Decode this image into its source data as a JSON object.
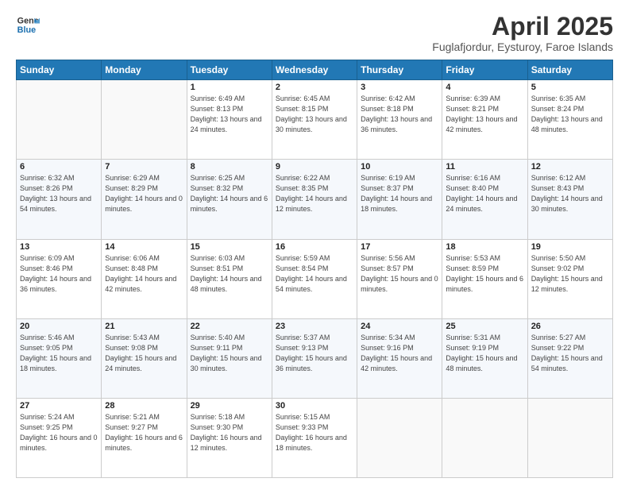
{
  "logo": {
    "line1": "General",
    "line2": "Blue"
  },
  "header": {
    "title": "April 2025",
    "subtitle": "Fuglafjordur, Eysturoy, Faroe Islands"
  },
  "weekdays": [
    "Sunday",
    "Monday",
    "Tuesday",
    "Wednesday",
    "Thursday",
    "Friday",
    "Saturday"
  ],
  "weeks": [
    [
      {
        "day": "",
        "info": ""
      },
      {
        "day": "",
        "info": ""
      },
      {
        "day": "1",
        "info": "Sunrise: 6:49 AM\nSunset: 8:13 PM\nDaylight: 13 hours\nand 24 minutes."
      },
      {
        "day": "2",
        "info": "Sunrise: 6:45 AM\nSunset: 8:15 PM\nDaylight: 13 hours\nand 30 minutes."
      },
      {
        "day": "3",
        "info": "Sunrise: 6:42 AM\nSunset: 8:18 PM\nDaylight: 13 hours\nand 36 minutes."
      },
      {
        "day": "4",
        "info": "Sunrise: 6:39 AM\nSunset: 8:21 PM\nDaylight: 13 hours\nand 42 minutes."
      },
      {
        "day": "5",
        "info": "Sunrise: 6:35 AM\nSunset: 8:24 PM\nDaylight: 13 hours\nand 48 minutes."
      }
    ],
    [
      {
        "day": "6",
        "info": "Sunrise: 6:32 AM\nSunset: 8:26 PM\nDaylight: 13 hours\nand 54 minutes."
      },
      {
        "day": "7",
        "info": "Sunrise: 6:29 AM\nSunset: 8:29 PM\nDaylight: 14 hours\nand 0 minutes."
      },
      {
        "day": "8",
        "info": "Sunrise: 6:25 AM\nSunset: 8:32 PM\nDaylight: 14 hours\nand 6 minutes."
      },
      {
        "day": "9",
        "info": "Sunrise: 6:22 AM\nSunset: 8:35 PM\nDaylight: 14 hours\nand 12 minutes."
      },
      {
        "day": "10",
        "info": "Sunrise: 6:19 AM\nSunset: 8:37 PM\nDaylight: 14 hours\nand 18 minutes."
      },
      {
        "day": "11",
        "info": "Sunrise: 6:16 AM\nSunset: 8:40 PM\nDaylight: 14 hours\nand 24 minutes."
      },
      {
        "day": "12",
        "info": "Sunrise: 6:12 AM\nSunset: 8:43 PM\nDaylight: 14 hours\nand 30 minutes."
      }
    ],
    [
      {
        "day": "13",
        "info": "Sunrise: 6:09 AM\nSunset: 8:46 PM\nDaylight: 14 hours\nand 36 minutes."
      },
      {
        "day": "14",
        "info": "Sunrise: 6:06 AM\nSunset: 8:48 PM\nDaylight: 14 hours\nand 42 minutes."
      },
      {
        "day": "15",
        "info": "Sunrise: 6:03 AM\nSunset: 8:51 PM\nDaylight: 14 hours\nand 48 minutes."
      },
      {
        "day": "16",
        "info": "Sunrise: 5:59 AM\nSunset: 8:54 PM\nDaylight: 14 hours\nand 54 minutes."
      },
      {
        "day": "17",
        "info": "Sunrise: 5:56 AM\nSunset: 8:57 PM\nDaylight: 15 hours\nand 0 minutes."
      },
      {
        "day": "18",
        "info": "Sunrise: 5:53 AM\nSunset: 8:59 PM\nDaylight: 15 hours\nand 6 minutes."
      },
      {
        "day": "19",
        "info": "Sunrise: 5:50 AM\nSunset: 9:02 PM\nDaylight: 15 hours\nand 12 minutes."
      }
    ],
    [
      {
        "day": "20",
        "info": "Sunrise: 5:46 AM\nSunset: 9:05 PM\nDaylight: 15 hours\nand 18 minutes."
      },
      {
        "day": "21",
        "info": "Sunrise: 5:43 AM\nSunset: 9:08 PM\nDaylight: 15 hours\nand 24 minutes."
      },
      {
        "day": "22",
        "info": "Sunrise: 5:40 AM\nSunset: 9:11 PM\nDaylight: 15 hours\nand 30 minutes."
      },
      {
        "day": "23",
        "info": "Sunrise: 5:37 AM\nSunset: 9:13 PM\nDaylight: 15 hours\nand 36 minutes."
      },
      {
        "day": "24",
        "info": "Sunrise: 5:34 AM\nSunset: 9:16 PM\nDaylight: 15 hours\nand 42 minutes."
      },
      {
        "day": "25",
        "info": "Sunrise: 5:31 AM\nSunset: 9:19 PM\nDaylight: 15 hours\nand 48 minutes."
      },
      {
        "day": "26",
        "info": "Sunrise: 5:27 AM\nSunset: 9:22 PM\nDaylight: 15 hours\nand 54 minutes."
      }
    ],
    [
      {
        "day": "27",
        "info": "Sunrise: 5:24 AM\nSunset: 9:25 PM\nDaylight: 16 hours\nand 0 minutes."
      },
      {
        "day": "28",
        "info": "Sunrise: 5:21 AM\nSunset: 9:27 PM\nDaylight: 16 hours\nand 6 minutes."
      },
      {
        "day": "29",
        "info": "Sunrise: 5:18 AM\nSunset: 9:30 PM\nDaylight: 16 hours\nand 12 minutes."
      },
      {
        "day": "30",
        "info": "Sunrise: 5:15 AM\nSunset: 9:33 PM\nDaylight: 16 hours\nand 18 minutes."
      },
      {
        "day": "",
        "info": ""
      },
      {
        "day": "",
        "info": ""
      },
      {
        "day": "",
        "info": ""
      }
    ]
  ]
}
